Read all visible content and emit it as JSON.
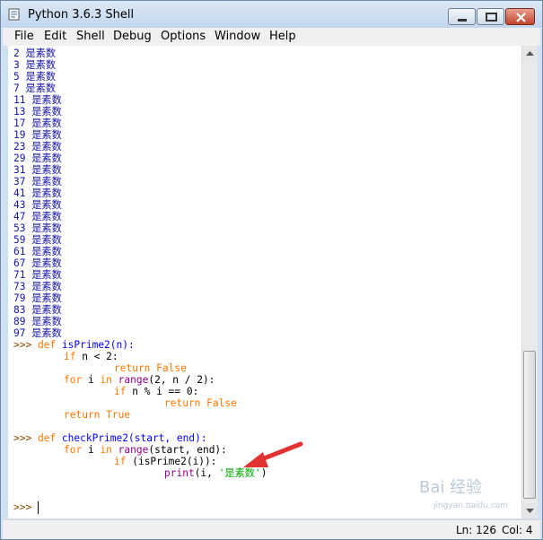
{
  "window": {
    "title": "Python 3.6.3 Shell"
  },
  "menu": [
    "File",
    "Edit",
    "Shell",
    "Debug",
    "Options",
    "Window",
    "Help"
  ],
  "output_suffix": "是素数",
  "output_numbers": [
    "2",
    "3",
    "5",
    "7",
    "11",
    "13",
    "17",
    "19",
    "23",
    "29",
    "31",
    "37",
    "41",
    "43",
    "47",
    "53",
    "59",
    "61",
    "67",
    "71",
    "73",
    "79",
    "83",
    "89",
    "97"
  ],
  "code": {
    "p1": ">>> ",
    "def1": "def ",
    "fn1": "isPrime2(n):",
    "l2a": "if ",
    "l2b": "n < 2:",
    "l3": "return False",
    "l4a": "for ",
    "l4b": "i ",
    "l4c": "in ",
    "l4d": "range",
    "l4e": "(2, n / 2):",
    "l5a": "if ",
    "l5b": "n % i == 0:",
    "l6": "return False",
    "l7": "return True",
    "p2": ">>> ",
    "def2": "def ",
    "fn2": "checkPrime2(start, end):",
    "l9a": "for ",
    "l9b": "i ",
    "l9c": "in ",
    "l9d": "range",
    "l9e": "(start, end):",
    "l10a": "if ",
    "l10b": "(isPrime2(i)):",
    "l11a": "print",
    "l11b": "(i, ",
    "l11c": "'是素数'",
    "l11d": ")",
    "prompt": ">>> "
  },
  "status": {
    "ln": "Ln: 126",
    "col": "Col: 4"
  },
  "watermark": {
    "text": "Bai 经验",
    "sub": "jingyan.baidu.com"
  }
}
